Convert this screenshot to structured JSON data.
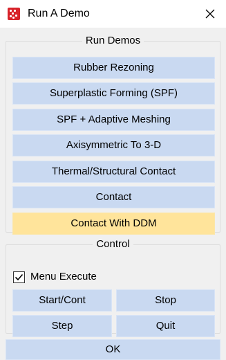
{
  "window": {
    "title": "Run A Demo",
    "app_icon": "app-logo-icon",
    "close_icon": "close-icon"
  },
  "run_demos": {
    "legend": "Run Demos",
    "buttons": [
      {
        "label": "Rubber Rezoning"
      },
      {
        "label": "Superplastic Forming (SPF)"
      },
      {
        "label": "SPF + Adaptive Meshing"
      },
      {
        "label": "Axisymmetric To 3-D"
      },
      {
        "label": "Thermal/Structural Contact"
      },
      {
        "label": "Contact"
      },
      {
        "label": "Contact With DDM",
        "highlighted": true
      }
    ]
  },
  "control": {
    "legend": "Control",
    "menu_execute": {
      "label": "Menu Execute",
      "checked": true
    },
    "start_cont_label": "Start/Cont",
    "stop_label": "Stop",
    "step_label": "Step",
    "quit_label": "Quit"
  },
  "ok_label": "OK",
  "colors": {
    "button_bg": "#c9d9f1",
    "highlight_bg": "#ffe49b",
    "dialog_bg": "#f0f0f0",
    "icon_red": "#d8232a"
  }
}
